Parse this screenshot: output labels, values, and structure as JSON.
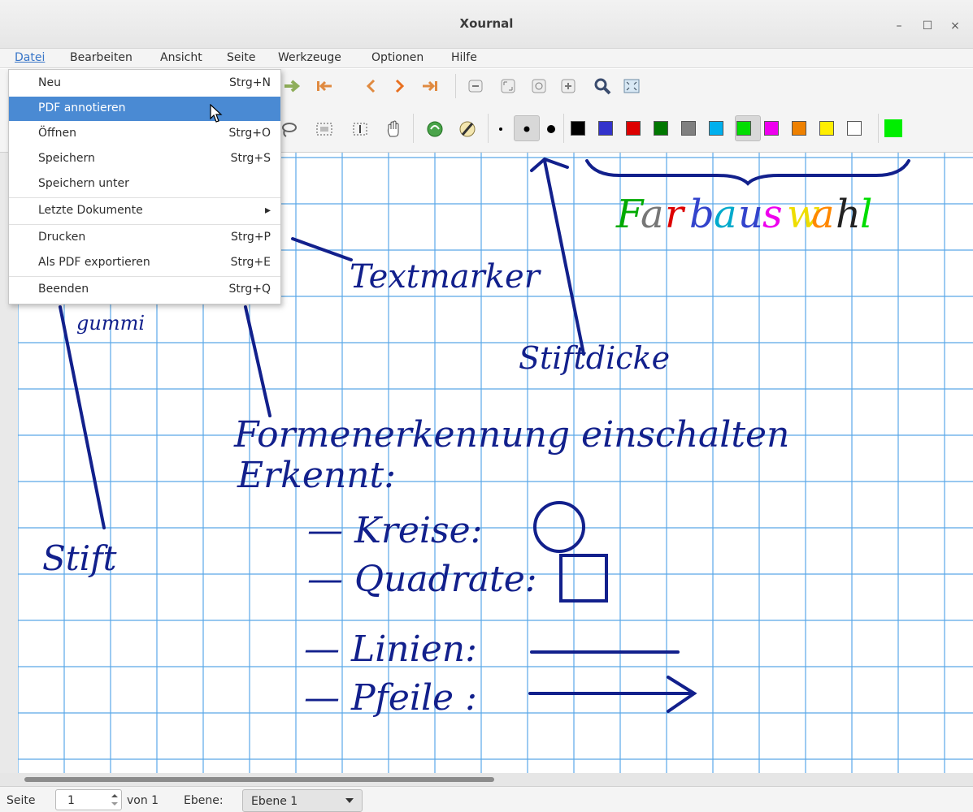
{
  "window": {
    "title": "Xournal",
    "minimize": "–",
    "maximize": "☐",
    "close": "×"
  },
  "menubar": [
    "Datei",
    "Bearbeiten",
    "Ansicht",
    "Seite",
    "Werkzeuge",
    "Optionen",
    "Hilfe"
  ],
  "file_menu": [
    {
      "label": "Neu",
      "shortcut": "Strg+N"
    },
    {
      "label": "PDF annotieren",
      "shortcut": ""
    },
    {
      "label": "Öffnen",
      "shortcut": "Strg+O"
    },
    {
      "label": "Speichern",
      "shortcut": "Strg+S"
    },
    {
      "label": "Speichern unter",
      "shortcut": ""
    },
    {
      "label": "Letzte Dokumente",
      "shortcut": "▸"
    },
    {
      "label": "Drucken",
      "shortcut": "Strg+P"
    },
    {
      "label": "Als PDF exportieren",
      "shortcut": "Strg+E"
    },
    {
      "label": "Beenden",
      "shortcut": "Strg+Q"
    }
  ],
  "palette": [
    "#000000",
    "#3333cc",
    "#dd0000",
    "#007700",
    "#808080",
    "#00b0ee",
    "#00dd00",
    "#ee00ee",
    "#ee8000",
    "#ffee00",
    "#ffffff"
  ],
  "current_color": "#00ee00",
  "handwriting": {
    "textmarker": "Textmarker",
    "gummi": "gummi",
    "stiftdicke": "Stiftdicke",
    "formen": "Formenerkennung einschalten",
    "erkennt": "Erkennt:",
    "kreise": "— Kreise:",
    "quadrate": "— Quadrate:",
    "linien": "— Linien:",
    "pfeile": "— Pfeile :",
    "stift": "Stift",
    "farbauswahl": [
      "F",
      "a",
      "r",
      "b",
      "a",
      "u",
      "s",
      "w",
      "a",
      "h",
      "l"
    ],
    "farbauswahl_colors": [
      "#00aa00",
      "#777777",
      "#dd0000",
      "#3344cc",
      "#00aacc",
      "#3344cc",
      "#ee00ee",
      "#eedd00",
      "#ff8800",
      "#222222",
      "#00dd00"
    ]
  },
  "statusbar": {
    "page_label": "Seite",
    "page_value": "1",
    "of_pages": "von 1",
    "layer_label": "Ebene:",
    "layer_value": "Ebene 1"
  }
}
